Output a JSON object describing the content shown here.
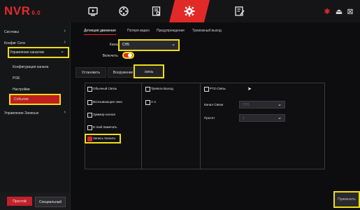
{
  "logo": {
    "name": "NVR",
    "version": "6.0"
  },
  "top_icons": [
    "monitor-icon",
    "playback-icon",
    "search-records-icon",
    "gear-icon",
    "edit-icon"
  ],
  "top_right_icons": [
    "alarm-icon",
    "user-icon",
    "exit-icon"
  ],
  "sidebar": {
    "items": [
      {
        "label": "Системы",
        "chevron": "›"
      },
      {
        "label": "Конфиг Сети",
        "chevron": "›"
      },
      {
        "label": "Управление каналом",
        "chevron": "⌄"
      },
      {
        "label": "Конфигурация канала"
      },
      {
        "label": "POE"
      },
      {
        "label": "Настройки"
      },
      {
        "label": "События"
      },
      {
        "label": "Управление Записью",
        "chevron": "›"
      }
    ]
  },
  "bottom_buttons": {
    "left": "Простой",
    "right": "Специальный"
  },
  "tabs": [
    "Детекция движения",
    "Потеря видео",
    "Предупреждение",
    "Тревожный выход"
  ],
  "form": {
    "channel_label": "Канал",
    "channel_value": "CH5",
    "enable_label": "Включить",
    "enabled": true
  },
  "subtabs": [
    "Установить",
    "Вооружение",
    "связь"
  ],
  "columns": {
    "col1": [
      {
        "label": "Обычный Связь",
        "checked": false
      },
      {
        "label": "Всплывающее окно",
        "checked": false
      },
      {
        "label": "Зуммер-сигнал",
        "checked": false
      },
      {
        "label": "E-mail Замечать",
        "checked": false
      },
      {
        "label": "Запись Канала",
        "checked": true
      }
    ],
    "col2": [
      {
        "label": "Тревога Выход",
        "checked": false
      },
      {
        "label": "A-1",
        "checked": false
      }
    ],
    "col3": {
      "ptz_label": "PTZ-Связь",
      "ptz_checked": false,
      "channel_label": "Канал Связи",
      "channel_value": "CH1",
      "preset_label": "Пресет",
      "preset_value": "1"
    }
  },
  "apply_label": "Применить",
  "accent": "#e12a28",
  "highlight": "#f0dc18"
}
